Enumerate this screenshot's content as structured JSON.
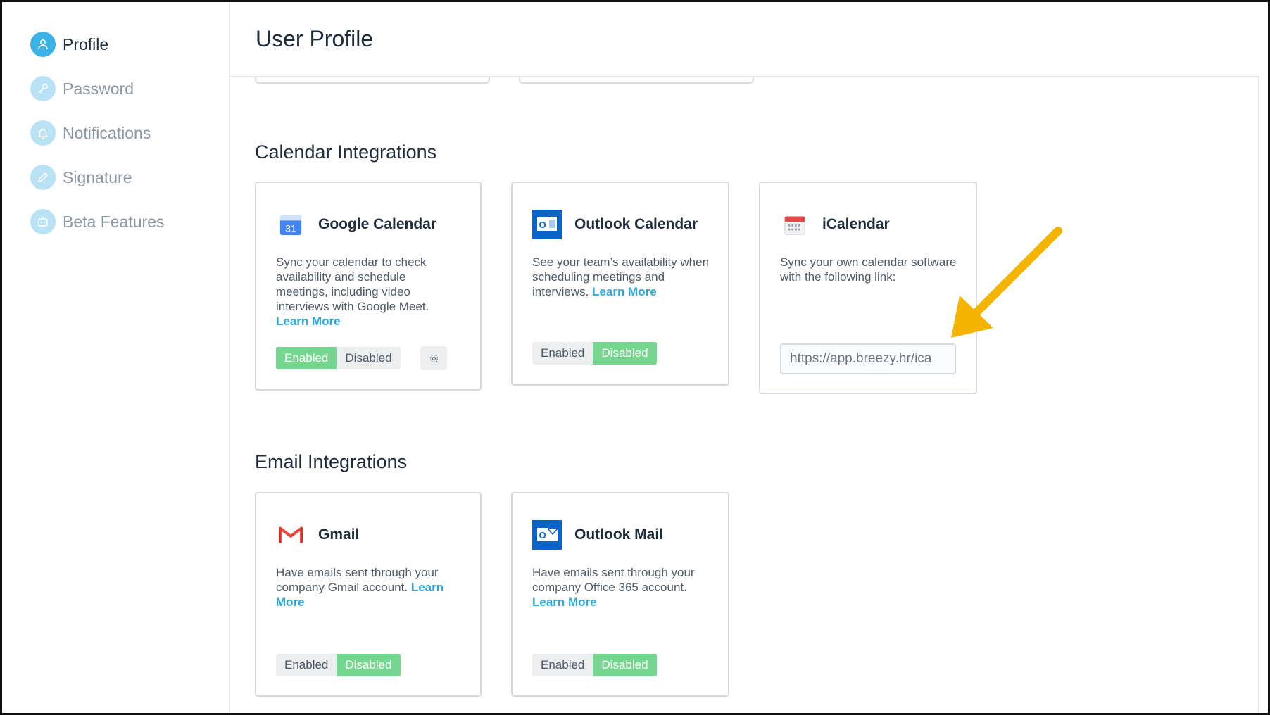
{
  "sidebar": {
    "items": [
      {
        "label": "Profile",
        "icon": "user-icon",
        "active": true
      },
      {
        "label": "Password",
        "icon": "key-icon",
        "active": false
      },
      {
        "label": "Notifications",
        "icon": "bell-icon",
        "active": false
      },
      {
        "label": "Signature",
        "icon": "pencil-icon",
        "active": false
      },
      {
        "label": "Beta Features",
        "icon": "robot-icon",
        "active": false
      }
    ]
  },
  "header": {
    "title": "User Profile"
  },
  "calendar": {
    "title": "Calendar Integrations",
    "google": {
      "title": "Google Calendar",
      "desc": "Sync your calendar to check availability and schedule meetings, including video interviews with Google Meet.",
      "link": "Learn More",
      "enabled_label": "Enabled",
      "disabled_label": "Disabled",
      "state": "Enabled"
    },
    "outlook": {
      "title": "Outlook Calendar",
      "desc": "See your team’s availability when scheduling meetings and interviews.",
      "link": "Learn More",
      "enabled_label": "Enabled",
      "disabled_label": "Disabled",
      "state": "Disabled"
    },
    "ical": {
      "title": "iCalendar",
      "desc": "Sync your own calendar software with the following link:",
      "link_value": "https://app.breezy.hr/ica"
    }
  },
  "email": {
    "title": "Email Integrations",
    "gmail": {
      "title": "Gmail",
      "desc": "Have emails sent through your company Gmail account.",
      "link": "Learn More",
      "enabled_label": "Enabled",
      "disabled_label": "Disabled",
      "state": "Disabled"
    },
    "outlook_mail": {
      "title": "Outlook Mail",
      "desc": "Have emails sent through your company Office 365 account.",
      "link": "Learn More",
      "enabled_label": "Enabled",
      "disabled_label": "Disabled",
      "state": "Disabled"
    }
  },
  "colors": {
    "accent": "#3bb3e6",
    "link": "#2da8df",
    "toggle_on": "#76d58e",
    "arrow": "#f5b400"
  }
}
